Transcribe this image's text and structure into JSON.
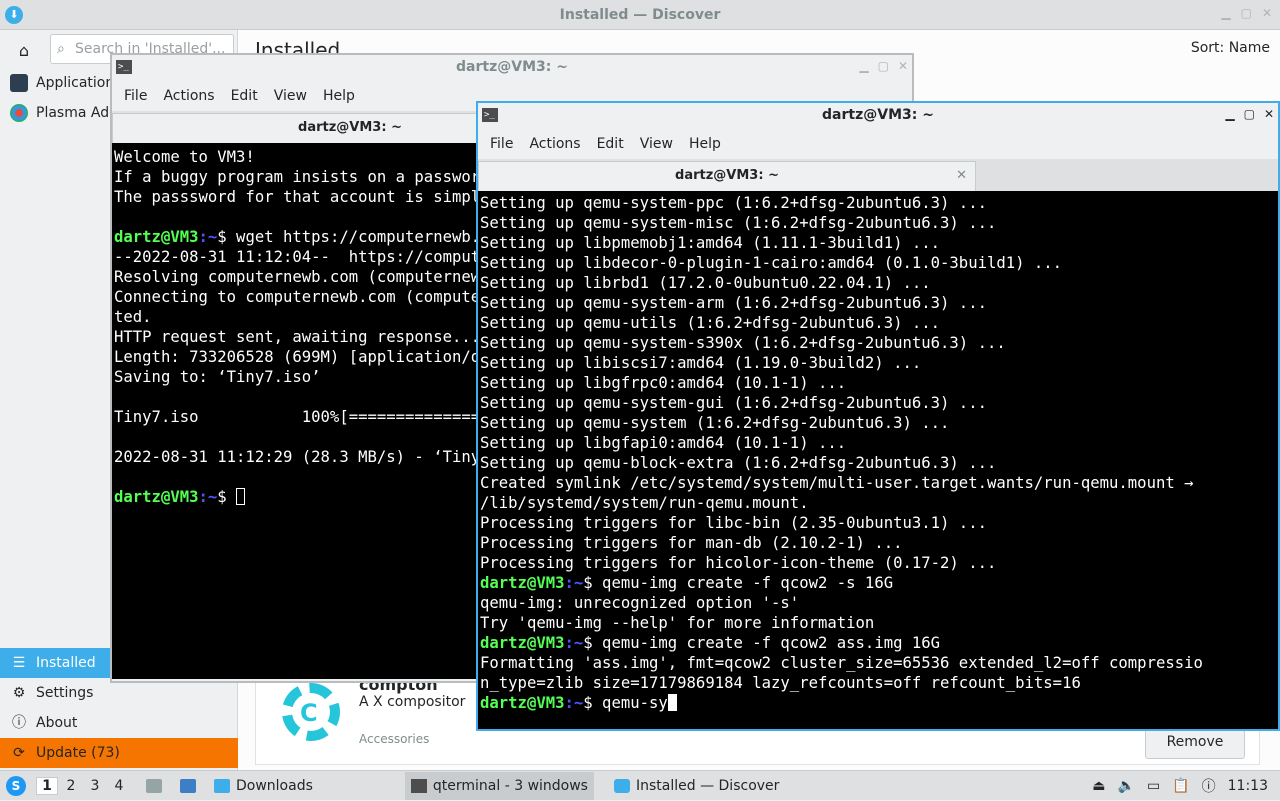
{
  "discover": {
    "title": "Installed — Discover",
    "search_placeholder": "Search in 'Installed'...",
    "page_title": "Installed",
    "sort_label": "Sort: Name",
    "sidebar_top": [
      "Applications",
      "Plasma Addons"
    ],
    "sidebar_bottom": {
      "installed": "Installed",
      "settings": "Settings",
      "about": "About",
      "update": "Update (73)"
    },
    "card": {
      "name": "compton",
      "description": "A X compositor",
      "category": "Accessories",
      "remove_label": "Remove"
    }
  },
  "term_back": {
    "title": "dartz@VM3: ~",
    "menu": [
      "File",
      "Actions",
      "Edit",
      "View",
      "Help"
    ],
    "tab": "dartz@VM3: ~",
    "lines": [
      "Welcome to VM3!",
      "If a buggy program insists on a password to do its job, make an account.",
      "The passsword for that account is simply 'password'.",
      "",
      "",
      "--2022-08-31 11:12:04--  https://computernewb.com/",
      "Resolving computernewb.com (computernewb.com)... ",
      "Connecting to computernewb.com (computernewb.com)... connec",
      "ted.",
      "HTTP request sent, awaiting response... 200 OK",
      "Length: 733206528 (699M) [application/octet-stream]",
      "Saving to: ‘Tiny7.iso’",
      "",
      "Tiny7.iso           100%[===================>]",
      "",
      "2022-08-31 11:12:29 (28.3 MB/s) - ‘Tiny7.iso’ saved",
      ""
    ],
    "prompt_user": "dartz@VM3",
    "prompt_path": ":~",
    "cmd_line4": "$ wget https://computernewb.com/",
    "cmd_last": "$ "
  },
  "term_front": {
    "title": "dartz@VM3: ~",
    "menu": [
      "File",
      "Actions",
      "Edit",
      "View",
      "Help"
    ],
    "tab": "dartz@VM3: ~",
    "lines": [
      "Setting up qemu-system-ppc (1:6.2+dfsg-2ubuntu6.3) ...",
      "Setting up qemu-system-misc (1:6.2+dfsg-2ubuntu6.3) ...",
      "Setting up libpmemobj1:amd64 (1.11.1-3build1) ...",
      "Setting up libdecor-0-plugin-1-cairo:amd64 (0.1.0-3build1) ...",
      "Setting up librbd1 (17.2.0-0ubuntu0.22.04.1) ...",
      "Setting up qemu-system-arm (1:6.2+dfsg-2ubuntu6.3) ...",
      "Setting up qemu-utils (1:6.2+dfsg-2ubuntu6.3) ...",
      "Setting up qemu-system-s390x (1:6.2+dfsg-2ubuntu6.3) ...",
      "Setting up libiscsi7:amd64 (1.19.0-3build2) ...",
      "Setting up libgfrpc0:amd64 (10.1-1) ...",
      "Setting up qemu-system-gui (1:6.2+dfsg-2ubuntu6.3) ...",
      "Setting up qemu-system (1:6.2+dfsg-2ubuntu6.3) ...",
      "Setting up libgfapi0:amd64 (10.1-1) ...",
      "Setting up qemu-block-extra (1:6.2+dfsg-2ubuntu6.3) ...",
      "Created symlink /etc/systemd/system/multi-user.target.wants/run-qemu.mount →",
      "/lib/systemd/system/run-qemu.mount.",
      "Processing triggers for libc-bin (2.35-0ubuntu3.1) ...",
      "Processing triggers for man-db (2.10.2-1) ...",
      "Processing triggers for hicolor-icon-theme (0.17-2) ..."
    ],
    "cmd1": "$ qemu-img create -f qcow2 -s 16G",
    "out1a": "qemu-img: unrecognized option '-s'",
    "out1b": "Try 'qemu-img --help' for more information",
    "cmd2": "$ qemu-img create -f qcow2 ass.img 16G",
    "out2a": "Formatting 'ass.img', fmt=qcow2 cluster_size=65536 extended_l2=off compressio",
    "out2b": "n_type=zlib size=17179869184 lazy_refcounts=off refcount_bits=16",
    "cmd3": "$ qemu-sy",
    "prompt_user": "dartz@VM3",
    "prompt_path": ":~"
  },
  "taskbar": {
    "desktops": [
      "1",
      "2",
      "3",
      "4"
    ],
    "downloads": "Downloads",
    "task_terminal": "qterminal - 3 windows",
    "task_discover": "Installed — Discover",
    "clock": "11:13"
  }
}
